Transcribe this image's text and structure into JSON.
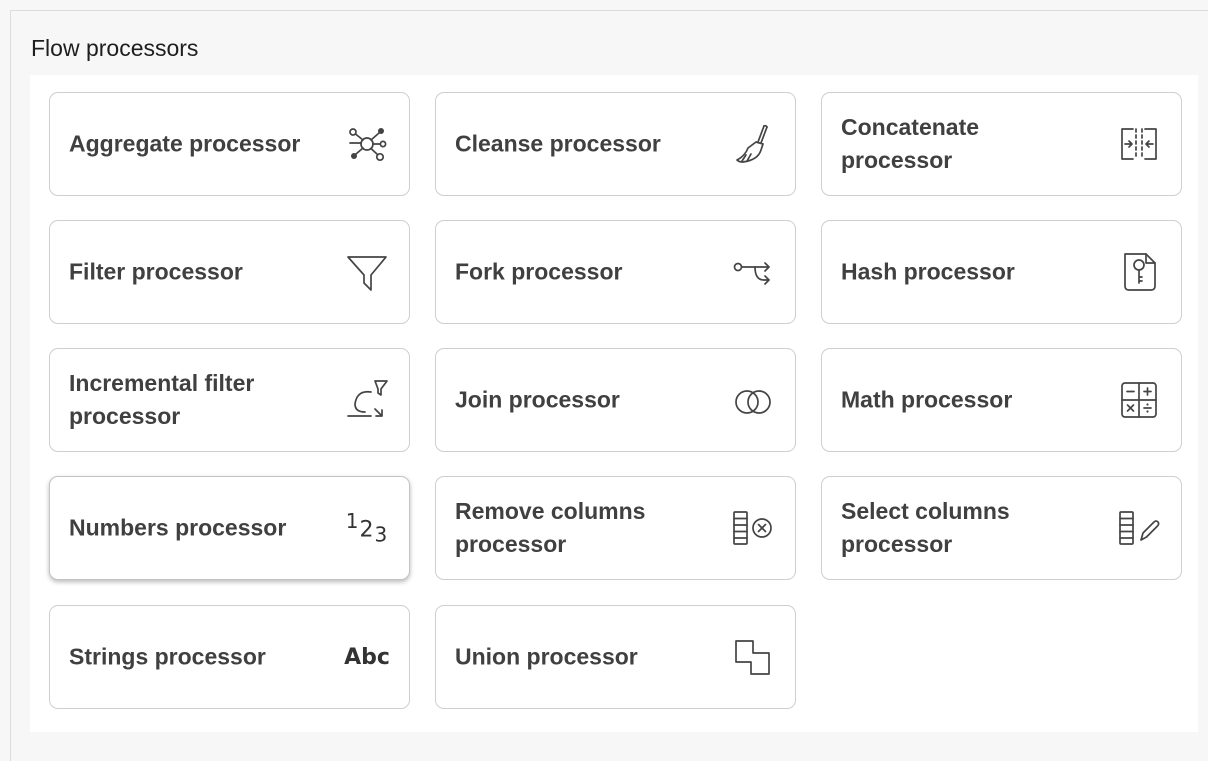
{
  "section": {
    "title": "Flow processors"
  },
  "processors": [
    {
      "label": "Aggregate processor",
      "icon": "network-icon"
    },
    {
      "label": "Cleanse processor",
      "icon": "brush-icon"
    },
    {
      "label": "Concatenate processor",
      "icon": "concatenate-icon"
    },
    {
      "label": "Filter processor",
      "icon": "funnel-icon"
    },
    {
      "label": "Fork processor",
      "icon": "fork-icon"
    },
    {
      "label": "Hash processor",
      "icon": "key-file-icon"
    },
    {
      "label": "Incremental filter processor",
      "icon": "incremental-filter-icon"
    },
    {
      "label": "Join processor",
      "icon": "join-circles-icon"
    },
    {
      "label": "Math processor",
      "icon": "calculator-icon"
    },
    {
      "label": "Numbers processor",
      "icon": "numbers-icon",
      "glyph": "123"
    },
    {
      "label": "Remove columns processor",
      "icon": "remove-columns-icon"
    },
    {
      "label": "Select columns processor",
      "icon": "select-columns-icon"
    },
    {
      "label": "Strings processor",
      "icon": "strings-icon",
      "glyph": "Abc"
    },
    {
      "label": "Union processor",
      "icon": "union-icon"
    }
  ],
  "colors": {
    "border": "#cfcfcf",
    "text": "#404040",
    "icon": "#444444",
    "background": "#f7f7f7"
  }
}
